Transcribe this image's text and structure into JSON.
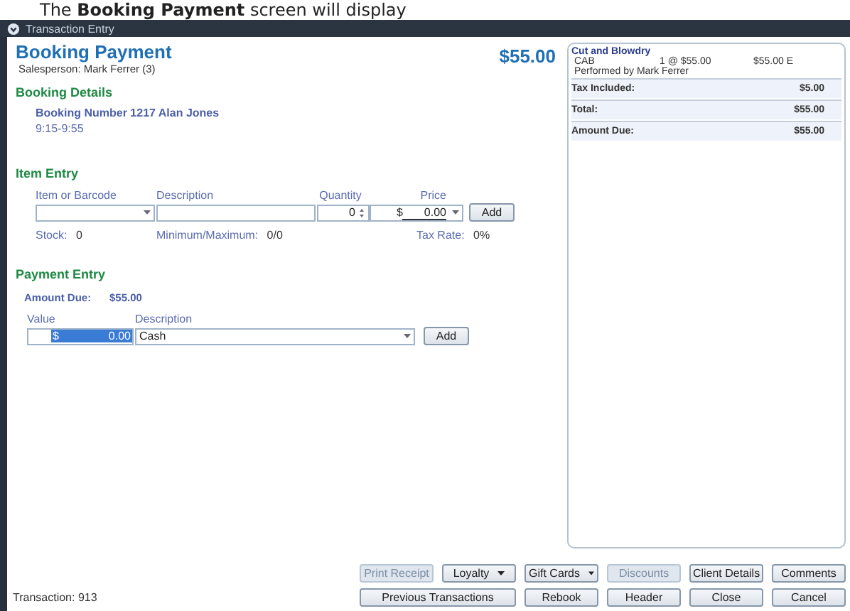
{
  "caption": "The **Booking Payment** screen will display",
  "window": {
    "title": "Transaction Entry"
  },
  "header": {
    "title": "Booking Payment",
    "salesperson": "Salesperson: Mark Ferrer (3)",
    "total": "$55.00"
  },
  "booking_details": {
    "heading": "Booking Details",
    "booking": "Booking Number 1217 Alan Jones",
    "time": "9:15-9:55"
  },
  "item_entry": {
    "heading": "Item Entry",
    "item_label": "Item or Barcode",
    "description_label": "Description",
    "quantity_label": "Quantity",
    "quantity": "0",
    "price_label": "Price",
    "price_currency": "$",
    "price": "0.00",
    "add_button": "Add",
    "stock_label": "Stock:",
    "stock": "0",
    "minmax_label": "Minimum/Maximum:",
    "minmax": "0/0",
    "tax_label": "Tax Rate:",
    "tax": "0%"
  },
  "payment_entry": {
    "heading": "Payment Entry",
    "amount_due_label": "Amount Due:",
    "amount_due": "$55.00",
    "value_label": "Value",
    "value_currency": "$",
    "value": "0.00",
    "value_selected": true,
    "description_label": "Description",
    "description": "Cash",
    "add_button": "Add"
  },
  "summary": {
    "items": [
      {
        "name": "Cut and Blowdry",
        "code": "CAB",
        "qty": "1 @ $55.00",
        "amount": "$55.00 E",
        "performer": "Performed by Mark Ferrer"
      }
    ],
    "totals": [
      {
        "label": "Tax Included:",
        "value": "$5.00"
      },
      {
        "label": "Total:",
        "value": "$55.00"
      },
      {
        "label": "Amount Due:",
        "value": "$55.00"
      }
    ]
  },
  "button_rows": [
    [
      {
        "label": "Print Receipt",
        "kind": "plain",
        "disabled": true
      },
      {
        "label": "Loyalty",
        "kind": "dropdown",
        "disabled": false
      },
      {
        "label": "Gift Cards",
        "kind": "dropdown",
        "disabled": false
      },
      {
        "label": "Discounts",
        "kind": "plain",
        "disabled": true
      },
      {
        "label": "Client Details",
        "kind": "plain",
        "disabled": false
      },
      {
        "label": "Comments",
        "kind": "plain",
        "disabled": false
      }
    ],
    [
      {
        "label": "Previous Transactions",
        "kind": "wide",
        "disabled": false
      },
      {
        "label": "Rebook",
        "kind": "plain",
        "disabled": false
      },
      {
        "label": "Header",
        "kind": "plain",
        "disabled": false
      },
      {
        "label": "Close",
        "kind": "plain",
        "disabled": false
      },
      {
        "label": "Cancel",
        "kind": "plain",
        "disabled": false
      }
    ]
  ],
  "status": {
    "label": "Transaction:",
    "value": "913"
  }
}
